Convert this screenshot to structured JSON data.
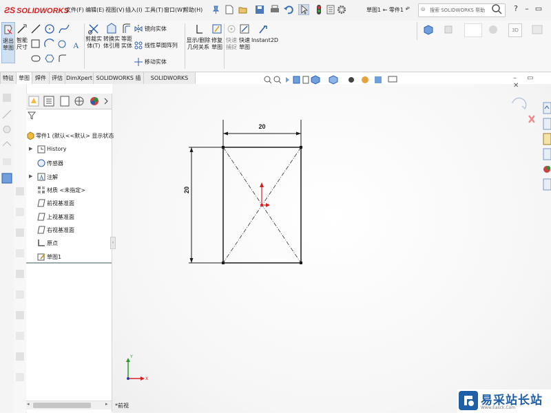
{
  "app": {
    "logo_text": "SOLIDWORKS",
    "document_title": "草图1 ← 零件1 *",
    "search_placeholder": "搜索 SOLIDWORKS 帮助"
  },
  "menu": [
    "文件(F)",
    "编辑(E)",
    "视图(V)",
    "插入(I)",
    "工具(T)",
    "窗口(W)",
    "帮助(H)"
  ],
  "command_manager": {
    "exit_sketch": [
      "退出",
      "草图"
    ],
    "smart_dimension": [
      "智能",
      "尺寸"
    ],
    "trim_entities": [
      "剪裁实",
      "体(T)"
    ],
    "convert_entities": [
      "转换实",
      "体引用"
    ],
    "offset_entities": [
      "等距",
      "实体"
    ],
    "mirror_entities": "镜向实体",
    "linear_pattern": "线性草图阵列",
    "move_entities": "移动实体",
    "display_relations": [
      "显示/删除",
      "几何关系"
    ],
    "repair_sketch": [
      "修复",
      "草图"
    ],
    "quick_snaps": [
      "快速",
      "捕捉"
    ],
    "rapid_sketch": [
      "快速",
      "草图"
    ],
    "instant2d": "Instant2D"
  },
  "tabs": [
    "特征",
    "草图",
    "焊件",
    "评估",
    "DimXpert",
    "SOLIDWORKS 插件",
    "SOLIDWORKS MBD"
  ],
  "active_tab": "草图",
  "feature_tree": {
    "root": "零件1 (默认<<默认> 显示状态",
    "items": [
      {
        "label": "History",
        "icon": "history-icon",
        "expandable": true
      },
      {
        "label": "传感器",
        "icon": "sensor-icon",
        "expandable": false
      },
      {
        "label": "注解",
        "icon": "annotation-icon",
        "expandable": true
      },
      {
        "label": "材质 <未指定>",
        "icon": "material-icon",
        "expandable": false
      },
      {
        "label": "前视基准面",
        "icon": "plane-icon",
        "expandable": false
      },
      {
        "label": "上视基准面",
        "icon": "plane-icon",
        "expandable": false
      },
      {
        "label": "右视基准面",
        "icon": "plane-icon",
        "expandable": false
      },
      {
        "label": "原点",
        "icon": "origin-icon",
        "expandable": false
      },
      {
        "label": "草图1",
        "icon": "sketch-icon",
        "expandable": false
      }
    ]
  },
  "sketch": {
    "width_dimension": "20",
    "height_dimension": "20"
  },
  "view_label": "*前视",
  "watermark": {
    "title": "易采站长站",
    "url": "Www.Easck.Com"
  },
  "colors": {
    "logo_red": "#d6201f",
    "sketch_line": "#1a1a1a",
    "watermark_blue": "#1f5fa8",
    "axis_red": "#d62020",
    "axis_green": "#2a9a2a",
    "axis_blue": "#2a3aa8"
  }
}
